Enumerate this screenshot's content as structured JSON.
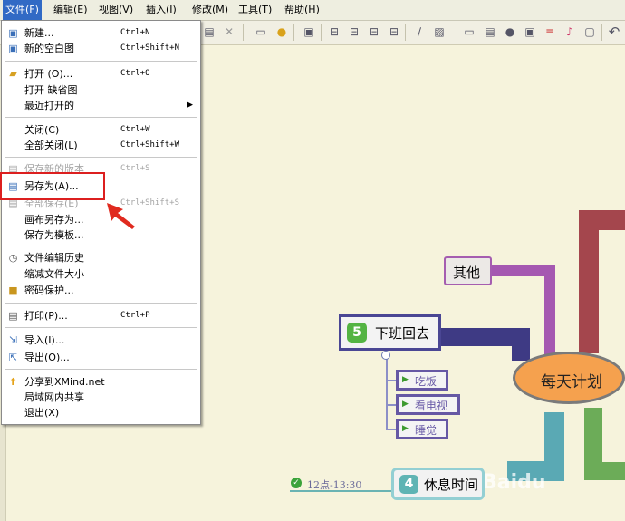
{
  "menubar": [
    {
      "label": "文件(F)"
    },
    {
      "label": "编辑(E)"
    },
    {
      "label": "视图(V)"
    },
    {
      "label": "插入(I)"
    },
    {
      "label": "修改(M)"
    },
    {
      "label": "工具(T)"
    },
    {
      "label": "帮助(H)"
    }
  ],
  "file_menu": {
    "new": {
      "label": "新建...",
      "shortcut": "Ctrl+N"
    },
    "new_blank": {
      "label": "新的空白图",
      "shortcut": "Ctrl+Shift+N"
    },
    "open": {
      "label": "打开 (O)...",
      "shortcut": "Ctrl+O"
    },
    "open_default": {
      "label": "打开 缺省图"
    },
    "recent": {
      "label": "最近打开的"
    },
    "close": {
      "label": "关闭(C)",
      "shortcut": "Ctrl+W"
    },
    "close_all": {
      "label": "全部关闭(L)",
      "shortcut": "Ctrl+Shift+W"
    },
    "save_new_version": {
      "label": "保存新的版本",
      "shortcut": "Ctrl+S"
    },
    "save_as": {
      "label": "另存为(A)..."
    },
    "save_all": {
      "label": "全部保存(E)",
      "shortcut": "Ctrl+Shift+S"
    },
    "save_canvas_as": {
      "label": "画布另存为..."
    },
    "save_as_template": {
      "label": "保存为模板..."
    },
    "history": {
      "label": "文件编辑历史"
    },
    "reduce_size": {
      "label": "缩减文件大小"
    },
    "password": {
      "label": "密码保护..."
    },
    "print": {
      "label": "打印(P)...",
      "shortcut": "Ctrl+P"
    },
    "import": {
      "label": "导入(I)..."
    },
    "export": {
      "label": "导出(O)..."
    },
    "share": {
      "label": "分享到XMind.net"
    },
    "lan_share": {
      "label": "局域网内共享"
    },
    "exit": {
      "label": "退出(X)"
    }
  },
  "mindmap": {
    "central": "每天计划",
    "other": "其他",
    "topic5": {
      "number": "5",
      "label": "下班回去"
    },
    "sub5": [
      "吃饭",
      "看电视",
      "睡觉"
    ],
    "topic4": {
      "number": "4",
      "label": "休息时间"
    },
    "time_label": "12点-13:30"
  },
  "watermark": "Baidu",
  "colors": {
    "menu_highlight": "#316ac5",
    "annotation": "#dc1f1f",
    "central_fill": "#f5a14e",
    "topic_border": "#6b5da8"
  }
}
